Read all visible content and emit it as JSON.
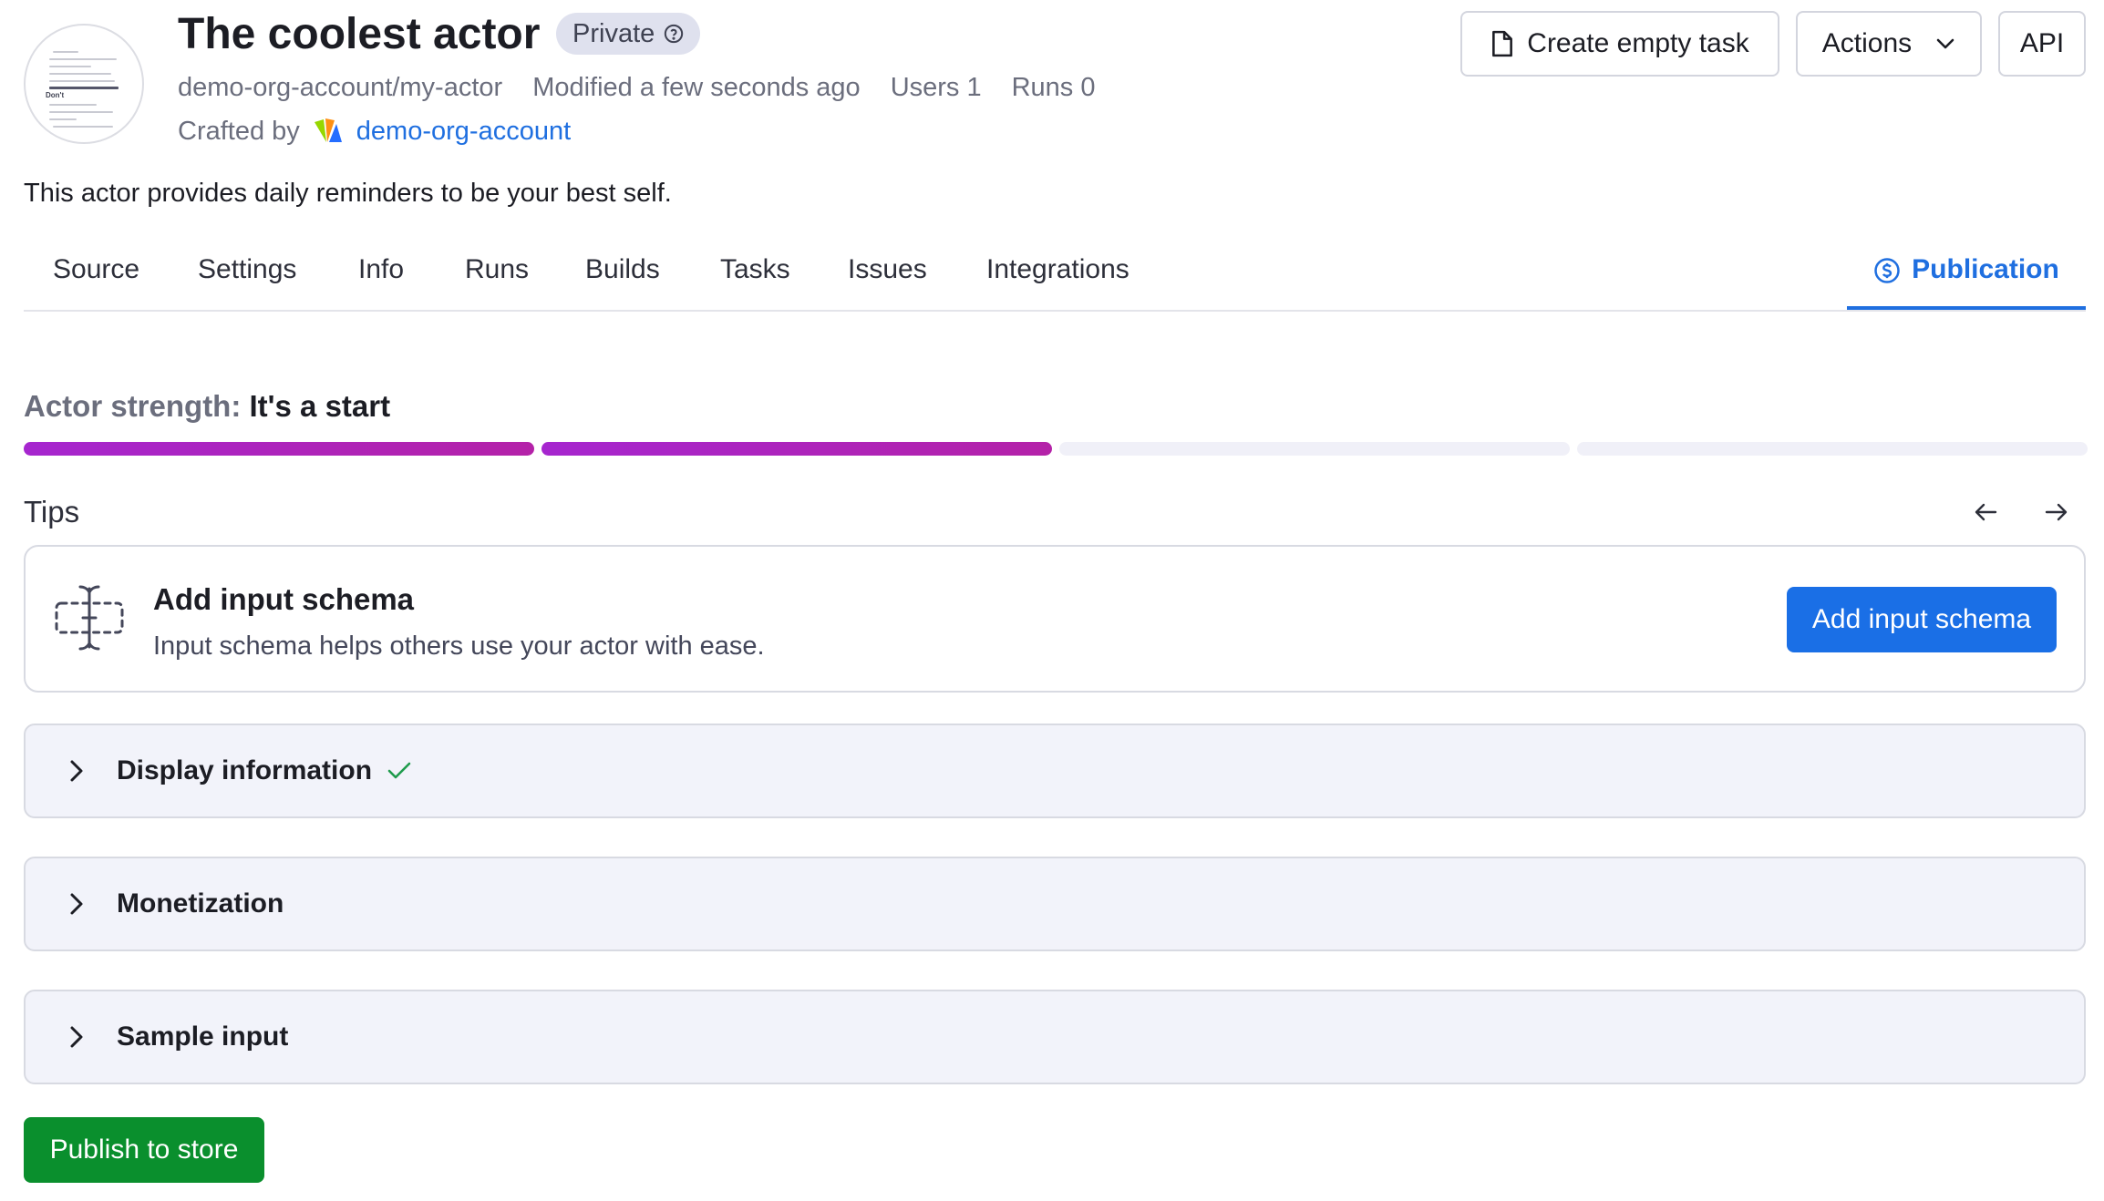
{
  "header": {
    "title": "The coolest actor",
    "badge": "Private",
    "meta": {
      "slug": "demo-org-account/my-actor",
      "modified": "Modified a few seconds ago",
      "users": "Users 1",
      "runs": "Runs 0"
    },
    "crafted_by_label": "Crafted by",
    "org_name": "demo-org-account",
    "avatar_label": "Don't",
    "create_task_label": "Create empty task",
    "actions_label": "Actions",
    "api_label": "API"
  },
  "description": "This actor provides daily reminders to be your best self.",
  "tabs": [
    {
      "label": "Source"
    },
    {
      "label": "Settings"
    },
    {
      "label": "Info"
    },
    {
      "label": "Runs"
    },
    {
      "label": "Builds"
    },
    {
      "label": "Tasks"
    },
    {
      "label": "Issues"
    },
    {
      "label": "Integrations"
    }
  ],
  "active_tab": "Publication",
  "strength": {
    "label": "Actor strength:",
    "value": "It's a start",
    "segments_total": 4,
    "segments_filled": 2
  },
  "tips": {
    "label": "Tips",
    "card": {
      "title": "Add input schema",
      "description": "Input schema helps others use your actor with ease.",
      "button": "Add input schema"
    }
  },
  "sections": [
    {
      "title": "Display information",
      "complete": true
    },
    {
      "title": "Monetization",
      "complete": false
    },
    {
      "title": "Sample input",
      "complete": false
    }
  ],
  "publish_label": "Publish to store",
  "colors": {
    "accent": "#1f6fe0",
    "primary_button": "#1a6fe6",
    "publish_button": "#0a8f2d",
    "strength_fill": "#a626cf",
    "check": "#1f9b4c"
  },
  "icons": {
    "badge": "question-circle-icon",
    "create_task": "document-icon",
    "actions": "chevron-down-icon",
    "publication": "dollar-circle-icon",
    "tip": "input-schema-icon",
    "tips_prev": "arrow-left-icon",
    "tips_next": "arrow-right-icon",
    "section_toggle": "chevron-right-icon",
    "section_complete": "check-icon"
  }
}
